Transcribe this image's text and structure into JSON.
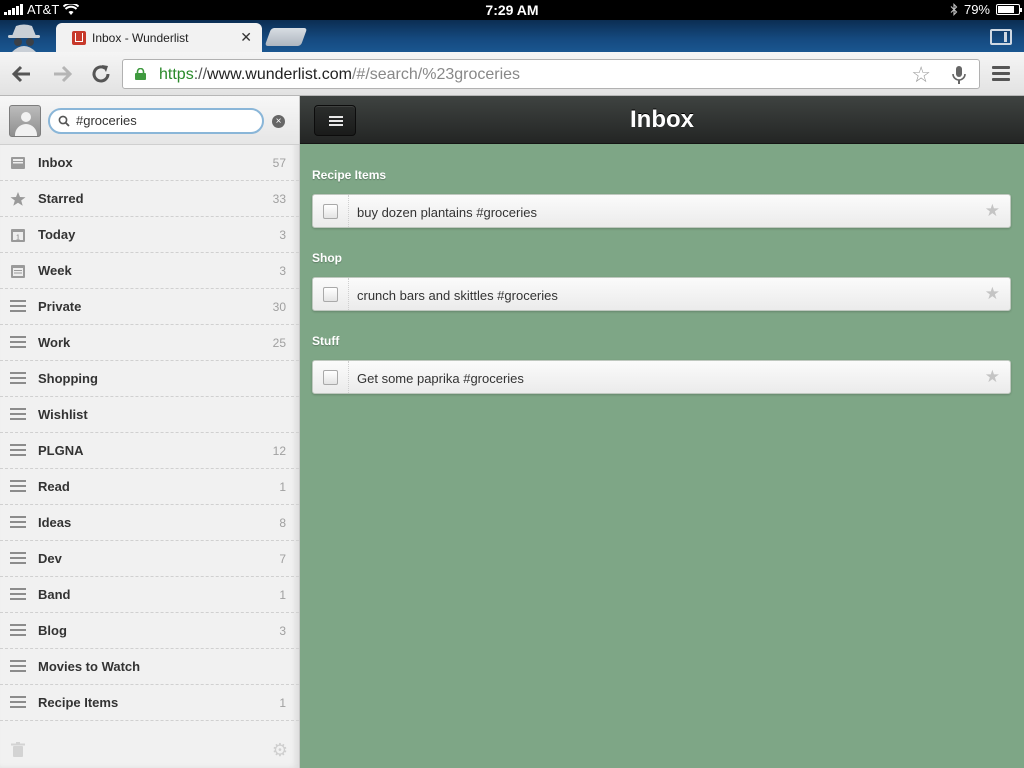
{
  "status_bar": {
    "carrier": "AT&T",
    "time": "7:29 AM",
    "battery": "79%",
    "battery_level": 0.79
  },
  "browser": {
    "tab_title": "Inbox - Wunderlist",
    "url_scheme": "https",
    "url_sep": "://",
    "url_host": "www.wunderlist.com",
    "url_path": "/#/search/%23groceries"
  },
  "sidebar": {
    "search_value": "#groceries",
    "lists": [
      {
        "label": "Inbox",
        "count": "57",
        "icon": "inbox-icon"
      },
      {
        "label": "Starred",
        "count": "33",
        "icon": "star-icon"
      },
      {
        "label": "Today",
        "count": "3",
        "icon": "calendar-today-icon"
      },
      {
        "label": "Week",
        "count": "3",
        "icon": "calendar-week-icon"
      },
      {
        "label": "Private",
        "count": "30",
        "icon": "list-icon"
      },
      {
        "label": "Work",
        "count": "25",
        "icon": "list-icon"
      },
      {
        "label": "Shopping",
        "count": "",
        "icon": "list-icon"
      },
      {
        "label": "Wishlist",
        "count": "",
        "icon": "list-icon"
      },
      {
        "label": "PLGNA",
        "count": "12",
        "icon": "list-icon"
      },
      {
        "label": "Read",
        "count": "1",
        "icon": "list-icon"
      },
      {
        "label": "Ideas",
        "count": "8",
        "icon": "list-icon"
      },
      {
        "label": "Dev",
        "count": "7",
        "icon": "list-icon"
      },
      {
        "label": "Band",
        "count": "1",
        "icon": "list-icon"
      },
      {
        "label": "Blog",
        "count": "3",
        "icon": "list-icon"
      },
      {
        "label": "Movies to Watch",
        "count": "",
        "icon": "list-icon"
      },
      {
        "label": "Recipe Items",
        "count": "1",
        "icon": "list-icon"
      }
    ]
  },
  "main": {
    "title": "Inbox",
    "groups": [
      {
        "title": "Recipe Items",
        "tasks": [
          {
            "text": "buy dozen plantains #groceries"
          }
        ]
      },
      {
        "title": "Shop",
        "tasks": [
          {
            "text": "crunch bars and skittles #groceries"
          }
        ]
      },
      {
        "title": "Stuff",
        "tasks": [
          {
            "text": "Get some paprika #groceries"
          }
        ]
      }
    ]
  },
  "colors": {
    "main_background": "#7ea686",
    "header_dark": "#2b2d2c",
    "tab_strip_blue": "#154a80",
    "url_scheme_green": "#2a8a2a"
  }
}
